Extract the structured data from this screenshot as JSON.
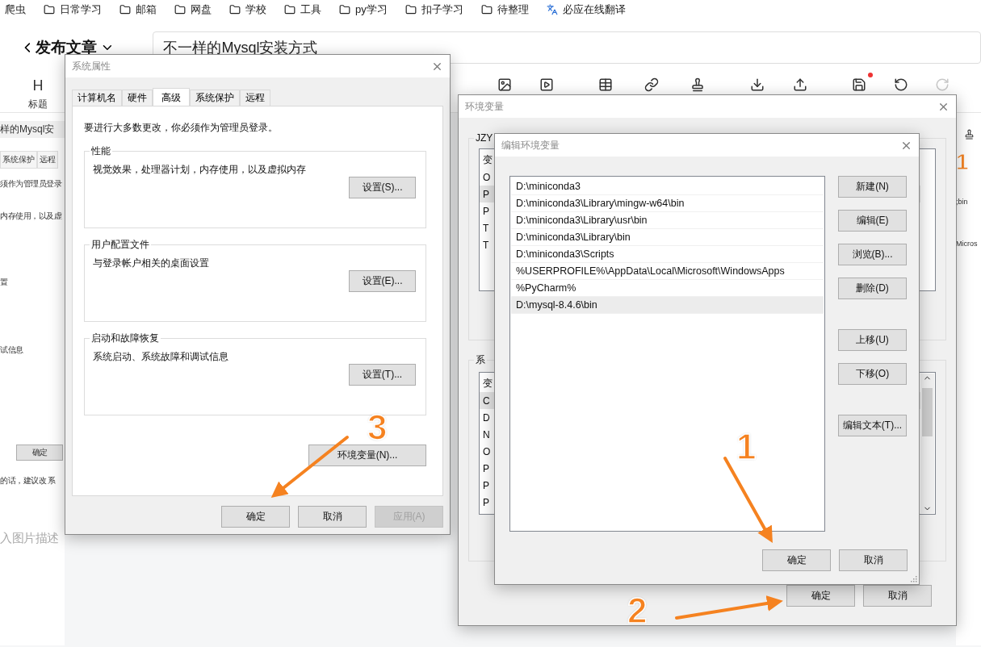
{
  "bookmarks": [
    {
      "label": "爬虫",
      "kind": "plain"
    },
    {
      "label": "日常学习",
      "kind": "folder"
    },
    {
      "label": "邮箱",
      "kind": "folder"
    },
    {
      "label": "网盘",
      "kind": "folder"
    },
    {
      "label": "学校",
      "kind": "folder"
    },
    {
      "label": "工具",
      "kind": "folder"
    },
    {
      "label": "py学习",
      "kind": "folder"
    },
    {
      "label": "扣子学习",
      "kind": "folder"
    },
    {
      "label": "待整理",
      "kind": "folder"
    },
    {
      "label": "必应在线翻译",
      "kind": "translate"
    }
  ],
  "editor": {
    "title": "发布文章",
    "article_title": "不一样的Mysql安装方式"
  },
  "toolbar": [
    {
      "kind": "heading",
      "glyph": "H",
      "label": "标题"
    },
    {
      "kind": "image"
    },
    {
      "kind": "video"
    },
    {
      "kind": "table"
    },
    {
      "kind": "link"
    },
    {
      "kind": "stamp"
    },
    {
      "kind": "download"
    },
    {
      "kind": "upload"
    },
    {
      "kind": "save",
      "unsaved": true
    },
    {
      "kind": "undo",
      "disabled": false
    },
    {
      "kind": "redo",
      "disabled": true
    }
  ],
  "left_fragments": [
    {
      "kind": "heading",
      "text": "样的Mysql安"
    },
    {
      "kind": "tabs",
      "items": [
        "系统保护",
        "远程"
      ]
    },
    {
      "kind": "text",
      "text": "须作为管理员登录"
    },
    {
      "kind": "text",
      "text": "内存使用，以及虚"
    },
    {
      "kind": "text",
      "text": "置"
    },
    {
      "kind": "text",
      "text": "试信息"
    },
    {
      "kind": "button",
      "text": "确定"
    },
    {
      "kind": "text",
      "text": "的话，建议改 系"
    },
    {
      "kind": "hint",
      "text": "入图片描述"
    }
  ],
  "right_fragments": [
    {
      "kind": "icon"
    },
    {
      "kind": "badge",
      "text": "1"
    },
    {
      "kind": "text",
      "text": ";bin"
    },
    {
      "kind": "text",
      "text": "Micros"
    }
  ],
  "system_properties": {
    "title": "系统属性",
    "tabs": [
      {
        "label": "计算机名",
        "selected": false
      },
      {
        "label": "硬件",
        "selected": false
      },
      {
        "label": "高级",
        "selected": true
      },
      {
        "label": "系统保护",
        "selected": false
      },
      {
        "label": "远程",
        "selected": false
      }
    ],
    "notice": "要进行大多数更改，你必须作为管理员登录。",
    "groups": [
      {
        "title": "性能",
        "text": "视觉效果，处理器计划，内存使用，以及虚拟内存",
        "button": "设置(S)..."
      },
      {
        "title": "用户配置文件",
        "text": "与登录帐户相关的桌面设置",
        "button": "设置(E)..."
      },
      {
        "title": "启动和故障恢复",
        "text": "系统启动、系统故障和调试信息",
        "button": "设置(T)..."
      }
    ],
    "env_button": "环境变量(N)...",
    "buttons": [
      {
        "label": "确定",
        "disabled": false
      },
      {
        "label": "取消",
        "disabled": false
      },
      {
        "label": "应用(A)",
        "disabled": true
      }
    ]
  },
  "environment_variables": {
    "title": "环境变量",
    "user_group": "JZY",
    "user_header": "变",
    "user_rows": [
      {
        "text": "O",
        "selected": false
      },
      {
        "text": "P",
        "selected": true
      },
      {
        "text": "P",
        "selected": false
      },
      {
        "text": "T",
        "selected": false
      },
      {
        "text": "T",
        "selected": false
      }
    ],
    "system_group": "系",
    "system_header": "变",
    "system_rows": [
      {
        "text": "C",
        "selected": true
      },
      {
        "text": "D",
        "selected": false
      },
      {
        "text": "N",
        "selected": false
      },
      {
        "text": "O",
        "selected": false
      },
      {
        "text": "P",
        "selected": false
      },
      {
        "text": "P",
        "selected": false
      },
      {
        "text": "P",
        "selected": false
      }
    ],
    "buttons": [
      "确定",
      "取消"
    ]
  },
  "edit_environment_variable": {
    "title": "编辑环境变量",
    "paths": [
      {
        "text": "D:\\miniconda3",
        "selected": false
      },
      {
        "text": "D:\\miniconda3\\Library\\mingw-w64\\bin",
        "selected": false
      },
      {
        "text": "D:\\miniconda3\\Library\\usr\\bin",
        "selected": false
      },
      {
        "text": "D:\\miniconda3\\Library\\bin",
        "selected": false
      },
      {
        "text": "D:\\miniconda3\\Scripts",
        "selected": false
      },
      {
        "text": "%USERPROFILE%\\AppData\\Local\\Microsoft\\WindowsApps",
        "selected": false
      },
      {
        "text": "%PyCharm%",
        "selected": false
      },
      {
        "text": "D:\\mysql-8.4.6\\bin",
        "selected": true
      }
    ],
    "side_buttons": [
      "新建(N)",
      "编辑(E)",
      "浏览(B)...",
      "删除(D)",
      "上移(U)",
      "下移(O)",
      "编辑文本(T)..."
    ],
    "buttons": [
      "确定",
      "取消"
    ]
  },
  "annotations": [
    {
      "label": "3"
    },
    {
      "label": "1"
    },
    {
      "label": "2"
    }
  ]
}
